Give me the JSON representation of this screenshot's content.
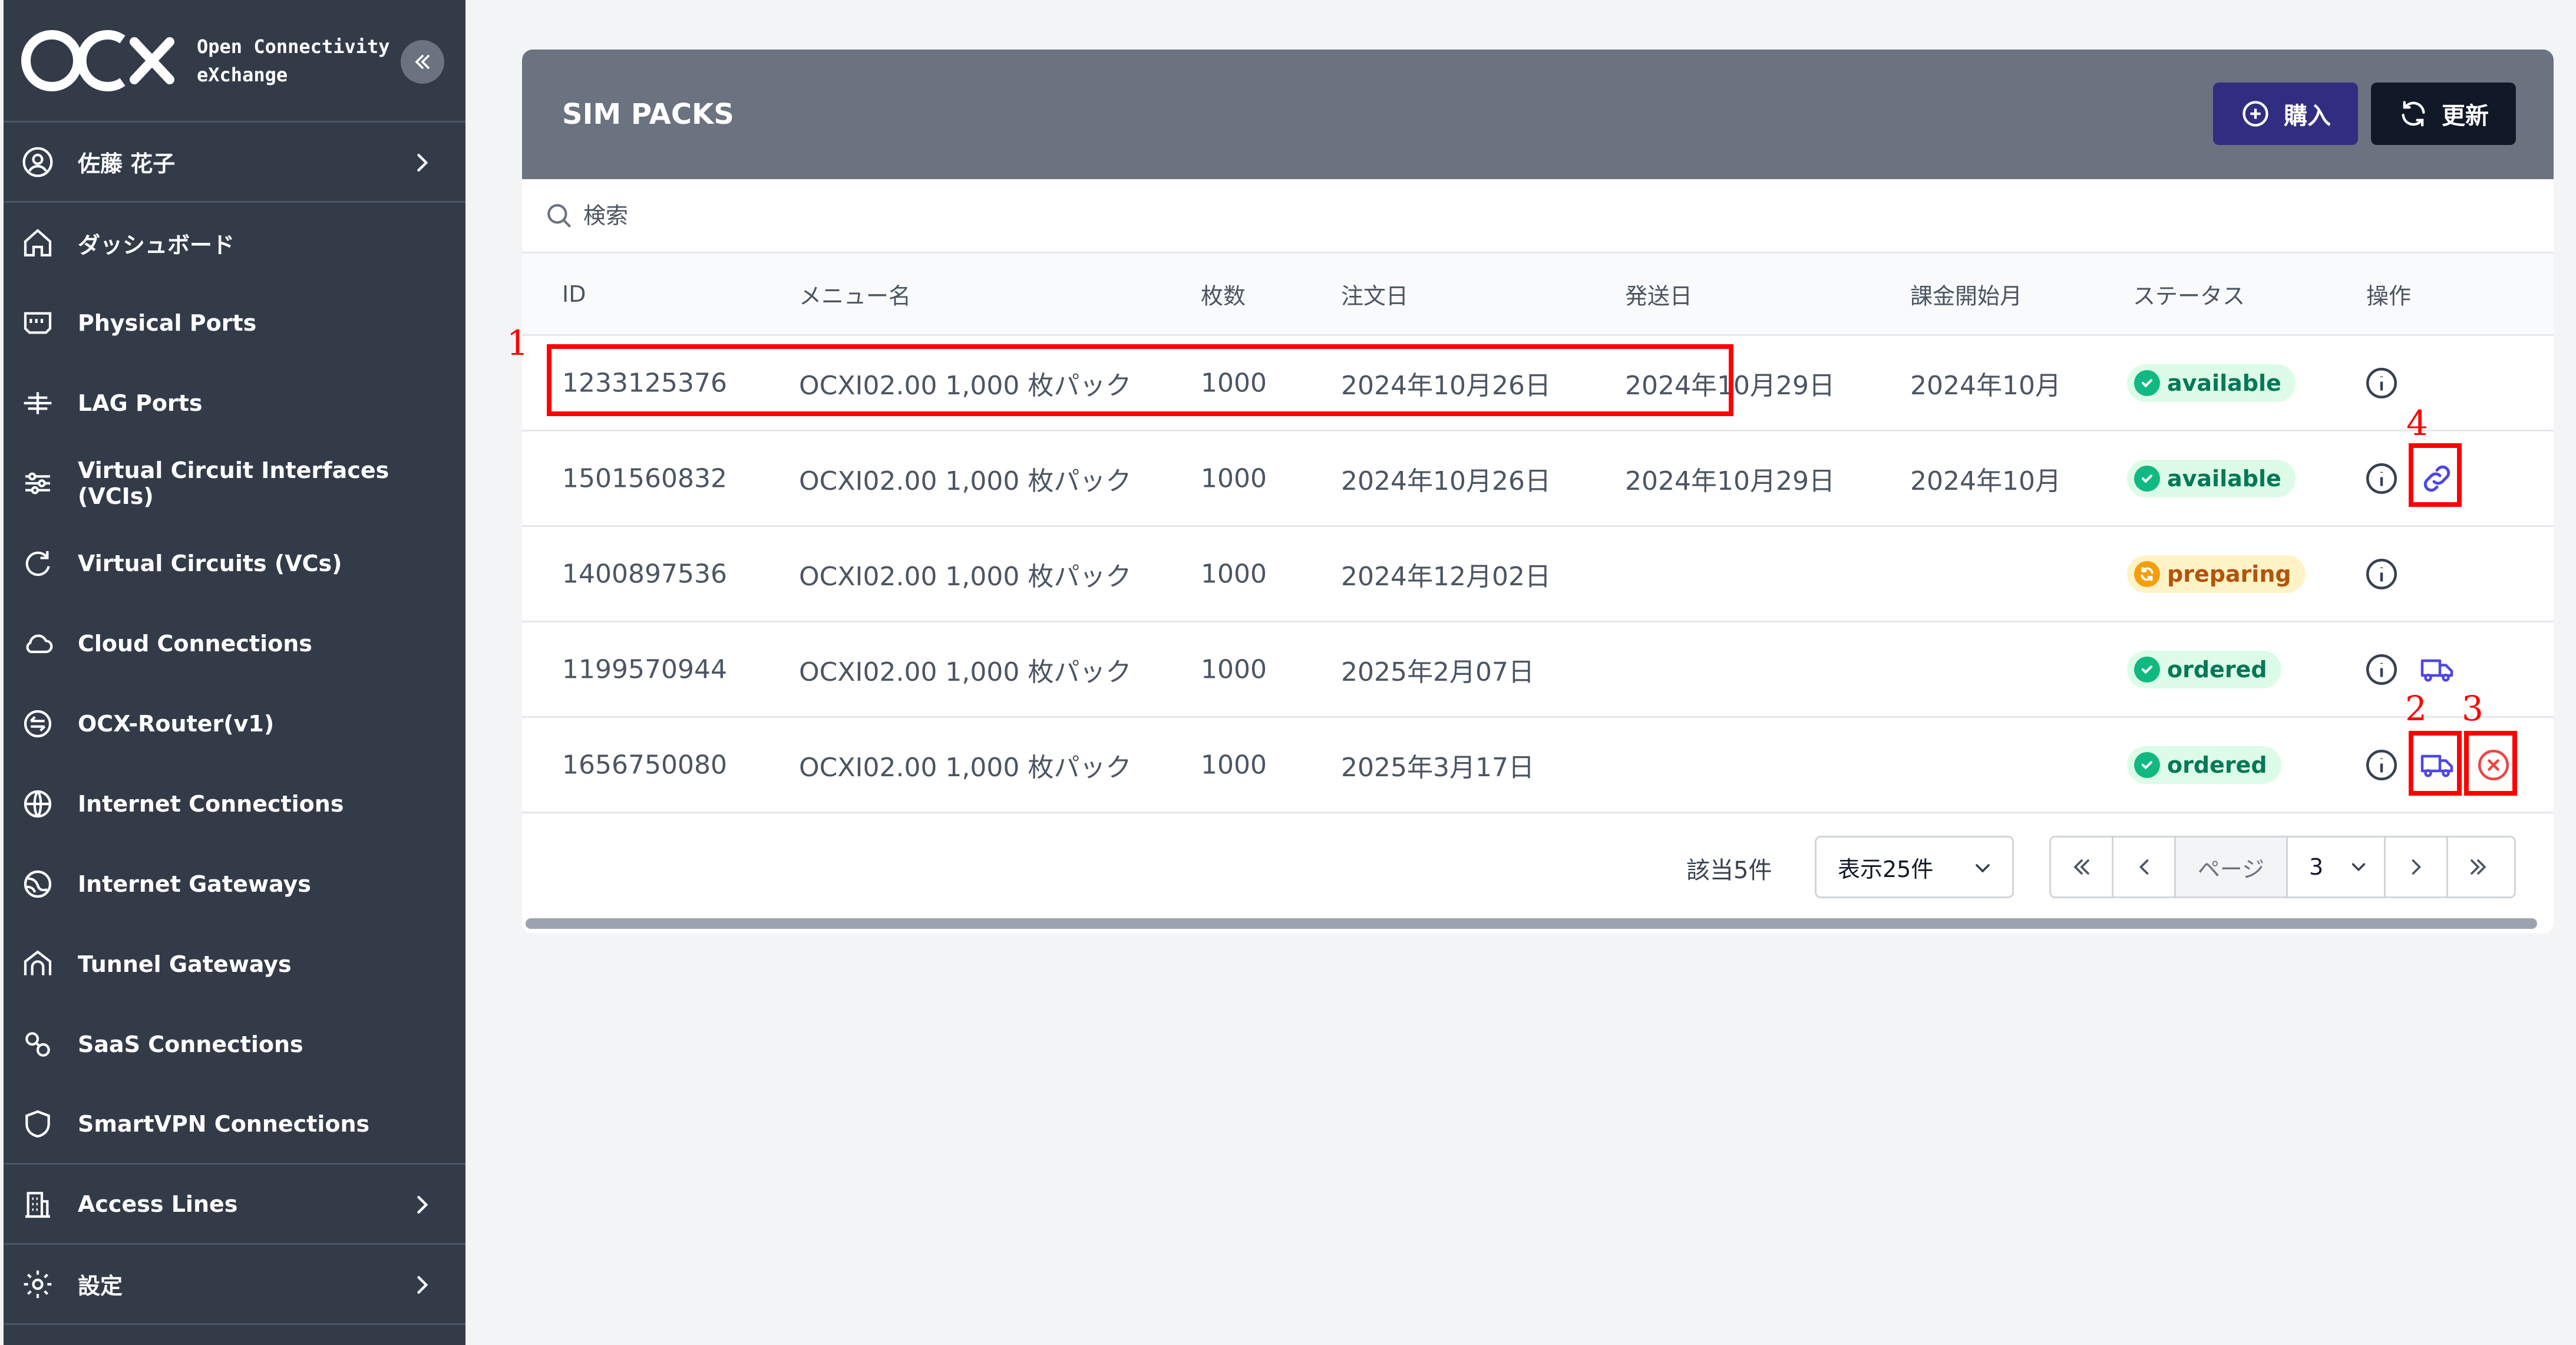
{
  "brand": {
    "line1": "Open Connectivity",
    "line2": "eXchange"
  },
  "sidebar": {
    "user": "佐藤 花子",
    "items": [
      {
        "label": "ダッシュボード",
        "icon": "home-icon"
      },
      {
        "label": "Physical Ports",
        "icon": "port-icon"
      },
      {
        "label": "LAG Ports",
        "icon": "lag-icon"
      },
      {
        "label": "Virtual Circuit Interfaces (VCIs)",
        "icon": "sliders-icon"
      },
      {
        "label": "Virtual Circuits (VCs)",
        "icon": "refresh-arc-icon"
      },
      {
        "label": "Cloud Connections",
        "icon": "cloud-icon"
      },
      {
        "label": "OCX-Router(v1)",
        "icon": "router-icon"
      },
      {
        "label": "Internet Connections",
        "icon": "globe-icon"
      },
      {
        "label": "Internet Gateways",
        "icon": "gateway-icon"
      },
      {
        "label": "Tunnel Gateways",
        "icon": "tunnel-icon"
      },
      {
        "label": "SaaS Connections",
        "icon": "saas-icon"
      },
      {
        "label": "SmartVPN Connections",
        "icon": "shield-icon"
      }
    ],
    "access_lines": "Access Lines",
    "settings": "設定"
  },
  "header": {
    "title": "SIM PACKS",
    "buy_label": "購入",
    "refresh_label": "更新"
  },
  "search": {
    "placeholder": "検索"
  },
  "table": {
    "columns": [
      "ID",
      "メニュー名",
      "枚数",
      "注文日",
      "発送日",
      "課金開始月",
      "ステータス",
      "操作"
    ],
    "rows": [
      {
        "id": "1233125376",
        "menu": "OCXI02.00 1,000 枚パック",
        "qty": "1000",
        "order": "2024年10月26日",
        "ship": "2024年10月29日",
        "bill": "2024年10月",
        "status": "available"
      },
      {
        "id": "1501560832",
        "menu": "OCXI02.00 1,000 枚パック",
        "qty": "1000",
        "order": "2024年10月26日",
        "ship": "2024年10月29日",
        "bill": "2024年10月",
        "status": "available"
      },
      {
        "id": "1400897536",
        "menu": "OCXI02.00 1,000 枚パック",
        "qty": "1000",
        "order": "2024年12月02日",
        "ship": "",
        "bill": "",
        "status": "preparing"
      },
      {
        "id": "1199570944",
        "menu": "OCXI02.00 1,000 枚パック",
        "qty": "1000",
        "order": "2025年2月07日",
        "ship": "",
        "bill": "",
        "status": "ordered"
      },
      {
        "id": "1656750080",
        "menu": "OCXI02.00 1,000 枚パック",
        "qty": "1000",
        "order": "2025年3月17日",
        "ship": "",
        "bill": "",
        "status": "ordered"
      }
    ]
  },
  "footer": {
    "count": "該当5件",
    "per_page": "表示25件",
    "page_label": "ページ",
    "page": "3"
  },
  "annotations": [
    "1",
    "2",
    "3",
    "4"
  ],
  "colors": {
    "sidebar_bg": "#333b49",
    "header_bg": "#6b7280",
    "buy_button": "#312e81",
    "refresh_button": "#111827",
    "available": "#10b981",
    "preparing": "#f59e0b",
    "action_blue": "#4f46e5",
    "cancel_red": "#ef4444",
    "annotation": "#ff0000"
  }
}
